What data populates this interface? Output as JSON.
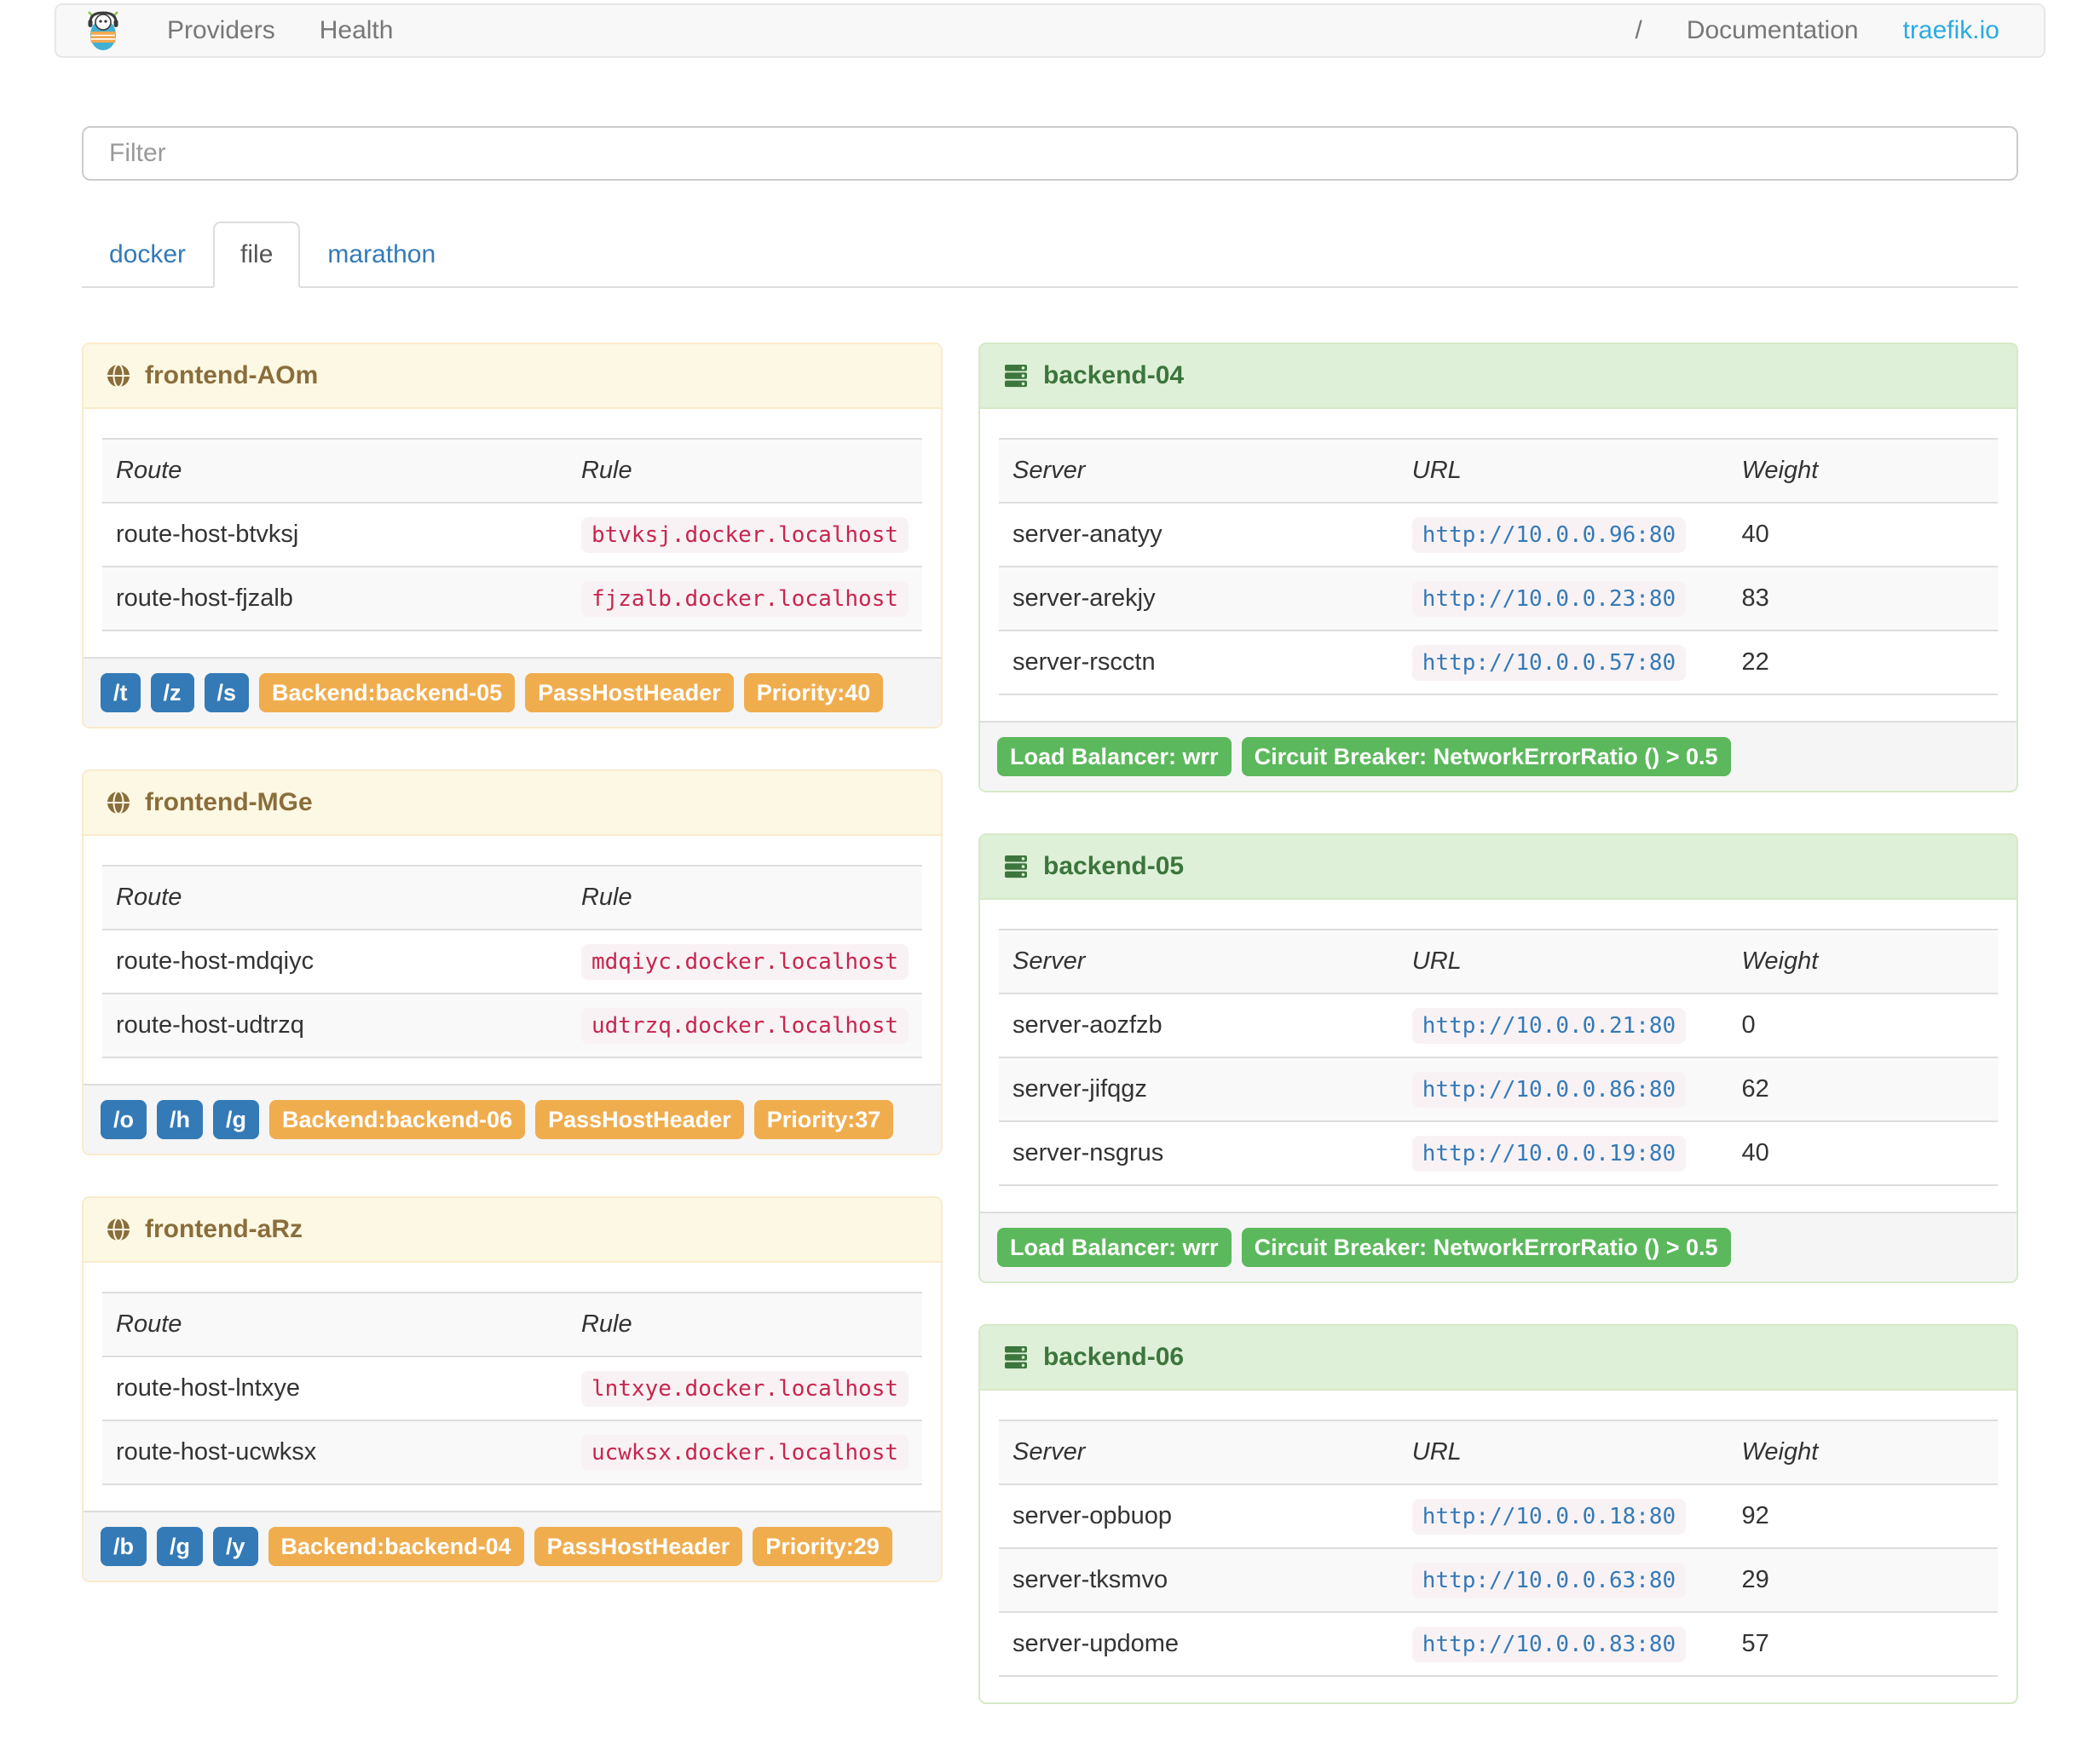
{
  "navbar": {
    "providers_label": "Providers",
    "health_label": "Health",
    "separator": "/",
    "documentation_label": "Documentation",
    "site_label": "traefik.io"
  },
  "filter": {
    "placeholder": "Filter"
  },
  "tabs": [
    {
      "label": "docker",
      "active": false
    },
    {
      "label": "file",
      "active": true
    },
    {
      "label": "marathon",
      "active": false
    }
  ],
  "frontends": {
    "columns": [
      "Route",
      "Rule"
    ],
    "items": [
      {
        "name": "frontend-AOm",
        "routes": [
          {
            "route": "route-host-btvksj",
            "rule": "btvksj.docker.localhost"
          },
          {
            "route": "route-host-fjzalb",
            "rule": "fjzalb.docker.localhost"
          }
        ],
        "entrypoints": [
          "/t",
          "/z",
          "/s"
        ],
        "tags": [
          "Backend:backend-05",
          "PassHostHeader",
          "Priority:40"
        ]
      },
      {
        "name": "frontend-MGe",
        "routes": [
          {
            "route": "route-host-mdqiyc",
            "rule": "mdqiyc.docker.localhost"
          },
          {
            "route": "route-host-udtrzq",
            "rule": "udtrzq.docker.localhost"
          }
        ],
        "entrypoints": [
          "/o",
          "/h",
          "/g"
        ],
        "tags": [
          "Backend:backend-06",
          "PassHostHeader",
          "Priority:37"
        ]
      },
      {
        "name": "frontend-aRz",
        "routes": [
          {
            "route": "route-host-lntxye",
            "rule": "lntxye.docker.localhost"
          },
          {
            "route": "route-host-ucwksx",
            "rule": "ucwksx.docker.localhost"
          }
        ],
        "entrypoints": [
          "/b",
          "/g",
          "/y"
        ],
        "tags": [
          "Backend:backend-04",
          "PassHostHeader",
          "Priority:29"
        ]
      }
    ]
  },
  "backends": {
    "columns": [
      "Server",
      "URL",
      "Weight"
    ],
    "items": [
      {
        "name": "backend-04",
        "servers": [
          {
            "server": "server-anatyy",
            "url": "http://10.0.0.96:80",
            "weight": "40"
          },
          {
            "server": "server-arekjy",
            "url": "http://10.0.0.23:80",
            "weight": "83"
          },
          {
            "server": "server-rscctn",
            "url": "http://10.0.0.57:80",
            "weight": "22"
          }
        ],
        "tags": [
          "Load Balancer: wrr",
          "Circuit Breaker: NetworkErrorRatio () > 0.5"
        ]
      },
      {
        "name": "backend-05",
        "servers": [
          {
            "server": "server-aozfzb",
            "url": "http://10.0.0.21:80",
            "weight": "0"
          },
          {
            "server": "server-jifqgz",
            "url": "http://10.0.0.86:80",
            "weight": "62"
          },
          {
            "server": "server-nsgrus",
            "url": "http://10.0.0.19:80",
            "weight": "40"
          }
        ],
        "tags": [
          "Load Balancer: wrr",
          "Circuit Breaker: NetworkErrorRatio () > 0.5"
        ]
      },
      {
        "name": "backend-06",
        "servers": [
          {
            "server": "server-opbuop",
            "url": "http://10.0.0.18:80",
            "weight": "92"
          },
          {
            "server": "server-tksmvo",
            "url": "http://10.0.0.63:80",
            "weight": "29"
          },
          {
            "server": "server-updome",
            "url": "http://10.0.0.83:80",
            "weight": "57"
          }
        ],
        "tags": []
      }
    ]
  },
  "colors": {
    "brand_blue": "#29abe2",
    "link_blue": "#337ab7",
    "frontend_header_bg": "#fcf8e3",
    "frontend_header_text": "#8a6d3b",
    "backend_header_bg": "#dff0d8",
    "backend_header_text": "#3c763d",
    "badge_blue": "#337ab7",
    "badge_orange": "#f0ad4e",
    "badge_green": "#5cb85c",
    "code_pink_text": "#c7254e",
    "code_bg": "#f9f2f4"
  }
}
